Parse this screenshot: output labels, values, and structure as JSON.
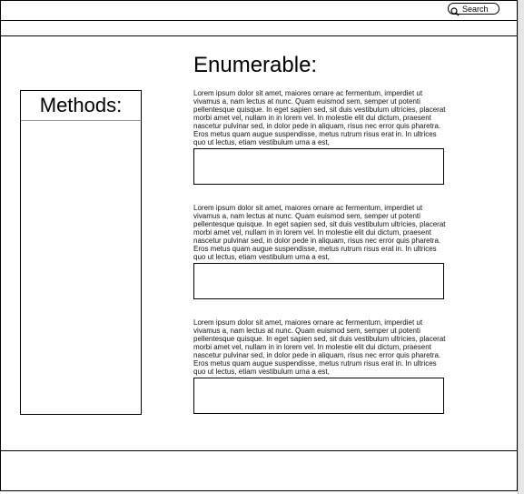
{
  "header": {
    "search_label": "Search",
    "search_icon": "search-icon"
  },
  "main": {
    "title": "Enumerable:"
  },
  "sidebar": {
    "title": "Methods:"
  },
  "sections": [
    {
      "text": "Lorem ipsum dolor sit amet, maiores ornare ac fermentum, imperdiet ut vivamus a, nam lectus at nunc. Quam euismod sem, semper ut potenti pellentesque quisque. In eget sapien sed, sit duis vestibulum ultricies, placerat morbi amet vel, nullam in in lorem vel. In molestie elit dui dictum, praesent nascetur pulvinar sed, in dolor pede in aliquam, risus nec error quis pharetra. Eros metus quam augue suspendisse, metus rutrum risus erat in.  In ultrices quo ut lectus, etiam vestibulum urna a est,"
    },
    {
      "text": "Lorem ipsum dolor sit amet, maiores ornare ac fermentum, imperdiet ut vivamus a, nam lectus at nunc. Quam euismod sem, semper ut potenti pellentesque quisque. In eget sapien sed, sit duis vestibulum ultricies, placerat morbi amet vel, nullam in in lorem vel. In molestie elit dui dictum, praesent nascetur pulvinar sed, in dolor pede in aliquam, risus nec error quis pharetra. Eros metus quam augue suspendisse, metus rutrum risus erat in.  In ultrices quo ut lectus, etiam vestibulum urna a est,"
    },
    {
      "text": "Lorem ipsum dolor sit amet, maiores ornare ac fermentum, imperdiet ut vivamus a, nam lectus at nunc. Quam euismod sem, semper ut potenti pellentesque quisque. In eget sapien sed, sit duis vestibulum ultricies, placerat morbi amet vel, nullam in in lorem vel. In molestie elit dui dictum, praesent nascetur pulvinar sed, in dolor pede in aliquam, risus nec error quis pharetra. Eros metus quam augue suspendisse, metus rutrum risus erat in.  In ultrices quo ut lectus, etiam vestibulum urna a est,"
    }
  ]
}
